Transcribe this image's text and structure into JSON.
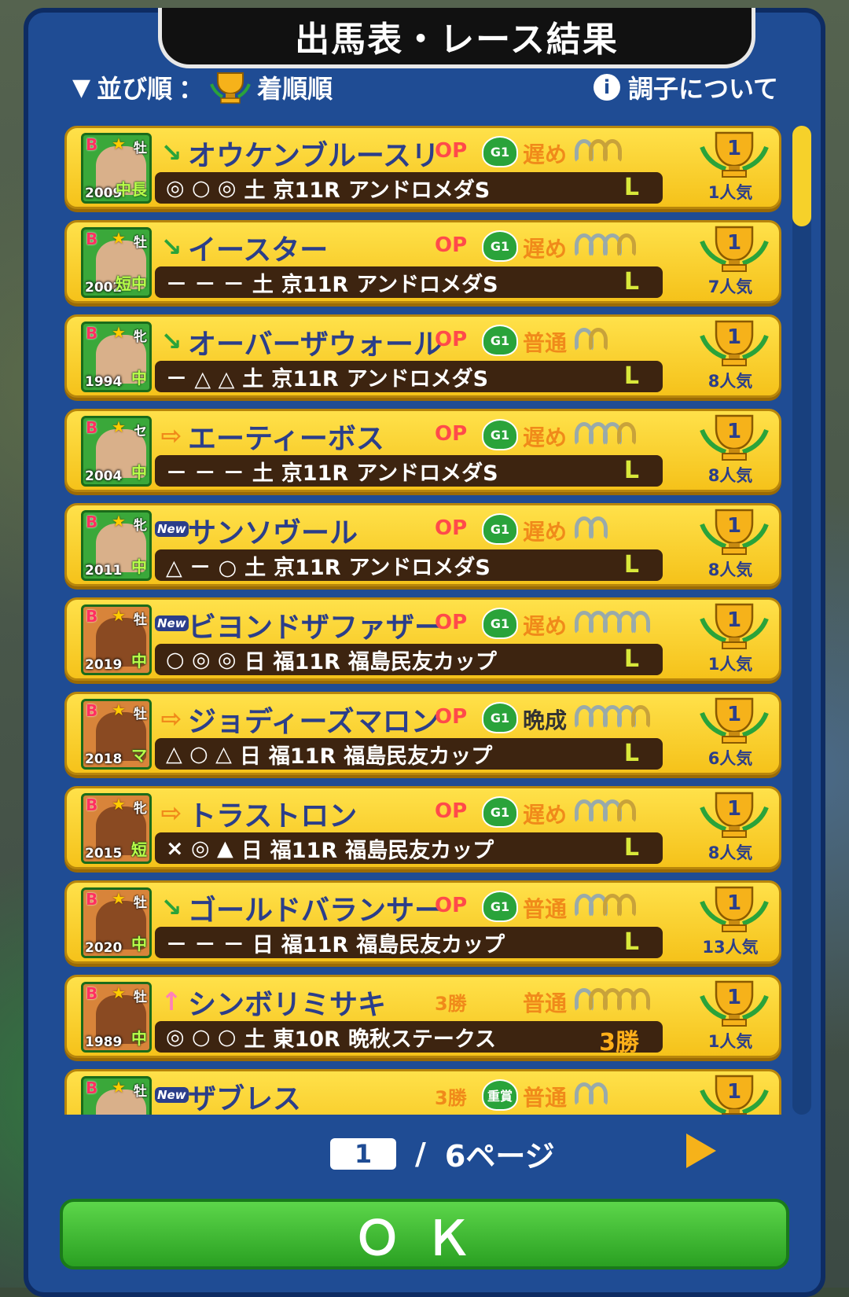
{
  "header": {
    "title": "出馬表・レース結果"
  },
  "sort": {
    "label": "並び順",
    "separator": "：",
    "value": "着順順"
  },
  "info": {
    "label": "調子について",
    "icon": "i"
  },
  "list": {
    "rows": [
      {
        "rank": "B",
        "sex": "牡",
        "year": "2009",
        "dist": "中長",
        "portrait": "green",
        "arrow": "↘",
        "arrow_kind": "down",
        "name": "オウケンブルースリ",
        "class": "OP",
        "grade": "G1",
        "growth": "遅め",
        "shoes_white": 1,
        "shoes_gold": 2,
        "marks": "◎ ○ ◎",
        "day": "土",
        "race": "京11R",
        "race_name": "アンドロメダS",
        "cond": "L",
        "place": "1",
        "popularity": "1人気"
      },
      {
        "rank": "B",
        "sex": "牡",
        "year": "2002",
        "dist": "短中",
        "portrait": "green",
        "arrow": "↘",
        "arrow_kind": "down",
        "name": "イースター",
        "class": "OP",
        "grade": "G1",
        "growth": "遅め",
        "shoes_white": 3,
        "shoes_gold": 1,
        "marks": "－ － －",
        "day": "土",
        "race": "京11R",
        "race_name": "アンドロメダS",
        "cond": "L",
        "place": "1",
        "popularity": "7人気"
      },
      {
        "rank": "B",
        "sex": "牝",
        "year": "1994",
        "dist": "中",
        "portrait": "green",
        "arrow": "↘",
        "arrow_kind": "down",
        "name": "オーバーザウォール",
        "class": "OP",
        "grade": "G1",
        "growth": "普通",
        "shoes_white": 1,
        "shoes_gold": 1,
        "marks": "－ △ △",
        "day": "土",
        "race": "京11R",
        "race_name": "アンドロメダS",
        "cond": "L",
        "place": "1",
        "popularity": "8人気"
      },
      {
        "rank": "B",
        "sex": "セ",
        "year": "2004",
        "dist": "中",
        "portrait": "green",
        "arrow": "⇨",
        "arrow_kind": "right",
        "name": "エーティーボス",
        "class": "OP",
        "grade": "G1",
        "growth": "遅め",
        "shoes_white": 3,
        "shoes_gold": 1,
        "marks": "－ － －",
        "day": "土",
        "race": "京11R",
        "race_name": "アンドロメダS",
        "cond": "L",
        "place": "1",
        "popularity": "8人気"
      },
      {
        "rank": "B",
        "sex": "牝",
        "year": "2011",
        "dist": "中",
        "portrait": "green",
        "arrow": "New",
        "arrow_kind": "new",
        "name": "サンソヴール",
        "class": "OP",
        "grade": "G1",
        "growth": "遅め",
        "shoes_white": 2,
        "shoes_gold": 0,
        "marks": "△ － ○",
        "day": "土",
        "race": "京11R",
        "race_name": "アンドロメダS",
        "cond": "L",
        "place": "1",
        "popularity": "8人気"
      },
      {
        "rank": "B",
        "sex": "牡",
        "year": "2019",
        "dist": "中",
        "portrait": "orange",
        "arrow": "New",
        "arrow_kind": "new",
        "name": "ビヨンドザファザー",
        "class": "OP",
        "grade": "G1",
        "growth": "遅め",
        "shoes_white": 5,
        "shoes_gold": 0,
        "marks": "○ ◎ ◎",
        "day": "日",
        "race": "福11R",
        "race_name": "福島民友カップ",
        "cond": "L",
        "place": "1",
        "popularity": "1人気"
      },
      {
        "rank": "B",
        "sex": "牡",
        "year": "2018",
        "dist": "マ",
        "portrait": "orange",
        "arrow": "⇨",
        "arrow_kind": "right",
        "name": "ジョディーズマロン",
        "class": "OP",
        "grade": "G1",
        "growth": "晩成",
        "shoes_white": 4,
        "shoes_gold": 1,
        "marks": "△ ○ △",
        "day": "日",
        "race": "福11R",
        "race_name": "福島民友カップ",
        "cond": "L",
        "place": "1",
        "popularity": "6人気"
      },
      {
        "rank": "B",
        "sex": "牝",
        "year": "2015",
        "dist": "短",
        "portrait": "orange",
        "arrow": "⇨",
        "arrow_kind": "right",
        "name": "トラストロン",
        "class": "OP",
        "grade": "G1",
        "growth": "遅め",
        "shoes_white": 3,
        "shoes_gold": 1,
        "marks": "× ◎ ▲",
        "day": "日",
        "race": "福11R",
        "race_name": "福島民友カップ",
        "cond": "L",
        "place": "1",
        "popularity": "8人気"
      },
      {
        "rank": "B",
        "sex": "牡",
        "year": "2020",
        "dist": "中",
        "portrait": "orange",
        "arrow": "↘",
        "arrow_kind": "down",
        "name": "ゴールドバランサー",
        "class": "OP",
        "grade": "G1",
        "growth": "普通",
        "shoes_white": 2,
        "shoes_gold": 2,
        "marks": "－ － －",
        "day": "日",
        "race": "福11R",
        "race_name": "福島民友カップ",
        "cond": "L",
        "place": "1",
        "popularity": "13人気"
      },
      {
        "rank": "B",
        "sex": "牡",
        "year": "1989",
        "dist": "中",
        "portrait": "orange",
        "arrow": "↑",
        "arrow_kind": "up",
        "name": "シンボリミサキ",
        "class": "3勝",
        "grade": "",
        "growth": "普通",
        "shoes_white": 1,
        "shoes_gold": 4,
        "marks": "◎ ○ ○",
        "day": "土",
        "race": "東10R",
        "race_name": "晩秋ステークス",
        "cond": "3勝",
        "place": "1",
        "popularity": "1人気"
      },
      {
        "rank": "B",
        "sex": "牡",
        "year": "",
        "dist": "",
        "portrait": "green",
        "arrow": "New",
        "arrow_kind": "new",
        "name": "ザブレス",
        "class": "3勝",
        "grade": "重賞",
        "growth": "普通",
        "shoes_white": 2,
        "shoes_gold": 0,
        "marks": "",
        "day": "",
        "race": "",
        "race_name": "",
        "cond": "",
        "place": "1",
        "popularity": ""
      }
    ]
  },
  "pager": {
    "current": "1",
    "separator": "/",
    "total": "6ページ"
  },
  "ok_button": {
    "label": "ＯＫ"
  },
  "colors": {
    "panel": "#1f4c94",
    "row": "#f5c21a",
    "ok": "#2aa022",
    "accent": "#f6b21a"
  }
}
